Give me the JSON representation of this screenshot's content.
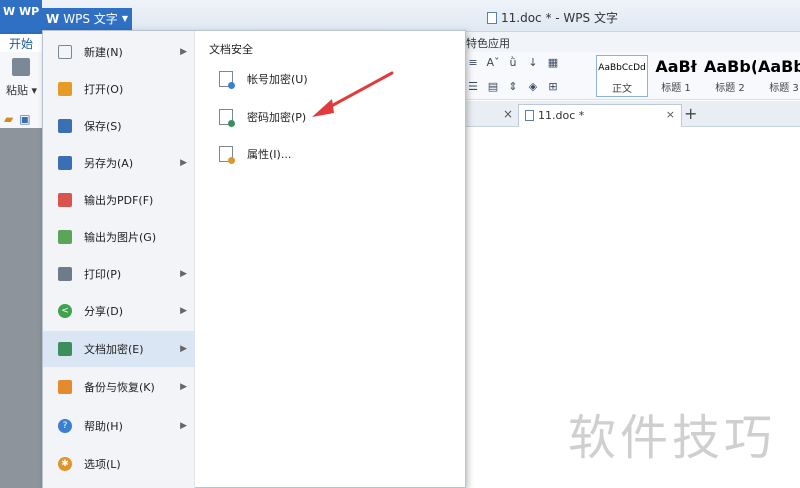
{
  "app": {
    "logo_left": "W WP",
    "wps_button": "WPS 文字",
    "wps_button_logo": "W",
    "window_title": "11.doc * - WPS 文字"
  },
  "ribbon": {
    "tab_start": "开始",
    "tab_special": "特色应用",
    "paste_label": "粘贴",
    "styles": [
      {
        "sample": "AaBbCcDd",
        "name": "正文",
        "active": true
      },
      {
        "sample": "AaBł",
        "name": "标题 1",
        "active": false
      },
      {
        "sample": "AaBb(",
        "name": "标题 2",
        "active": false
      },
      {
        "sample": "AaBbC",
        "name": "标题 3",
        "active": false
      }
    ]
  },
  "doc_tabs": {
    "active_tab": "11.doc *",
    "close": "×",
    "plus": "+"
  },
  "menu": {
    "items": [
      {
        "label": "新建(N)",
        "icon": "new-doc-icon",
        "color": "#e8edf3",
        "submenu": true
      },
      {
        "label": "打开(O)",
        "icon": "folder-open-icon",
        "color": "#e69a28",
        "submenu": false
      },
      {
        "label": "保存(S)",
        "icon": "save-icon",
        "color": "#3a6fb4",
        "submenu": false
      },
      {
        "label": "另存为(A)",
        "icon": "save-as-icon",
        "color": "#3a6fb4",
        "submenu": true
      },
      {
        "label": "输出为PDF(F)",
        "icon": "pdf-export-icon",
        "color": "#d9534f",
        "submenu": false
      },
      {
        "label": "输出为图片(G)",
        "icon": "image-export-icon",
        "color": "#5aa55a",
        "submenu": false
      },
      {
        "label": "打印(P)",
        "icon": "print-icon",
        "color": "#6d7b8a",
        "submenu": true
      },
      {
        "label": "分享(D)",
        "icon": "share-icon",
        "color": "#3fa34d",
        "submenu": true
      },
      {
        "label": "文档加密(E)",
        "icon": "encrypt-icon",
        "color": "#3c8f5a",
        "submenu": true,
        "active": true
      },
      {
        "label": "备份与恢复(K)",
        "icon": "backup-icon",
        "color": "#e68a2e",
        "submenu": true
      },
      {
        "label": "帮助(H)",
        "icon": "help-icon",
        "color": "#3a7fd0",
        "submenu": true
      },
      {
        "label": "选项(L)",
        "icon": "options-gear-icon",
        "color": "#e0952e",
        "submenu": false
      }
    ],
    "submenu": {
      "title": "文档安全",
      "items": [
        {
          "label": "帐号加密(U)",
          "icon": "account-lock-icon",
          "dot": "#3a7fd0"
        },
        {
          "label": "密码加密(P)",
          "icon": "password-lock-icon",
          "dot": "#3c8f5a"
        },
        {
          "label": "属性(I)...",
          "icon": "properties-icon",
          "dot": "#e0952e"
        }
      ]
    }
  },
  "watermark": "软件技巧",
  "colors": {
    "accent_blue": "#2f70c4",
    "annotation_arrow": "#e23b3b"
  }
}
